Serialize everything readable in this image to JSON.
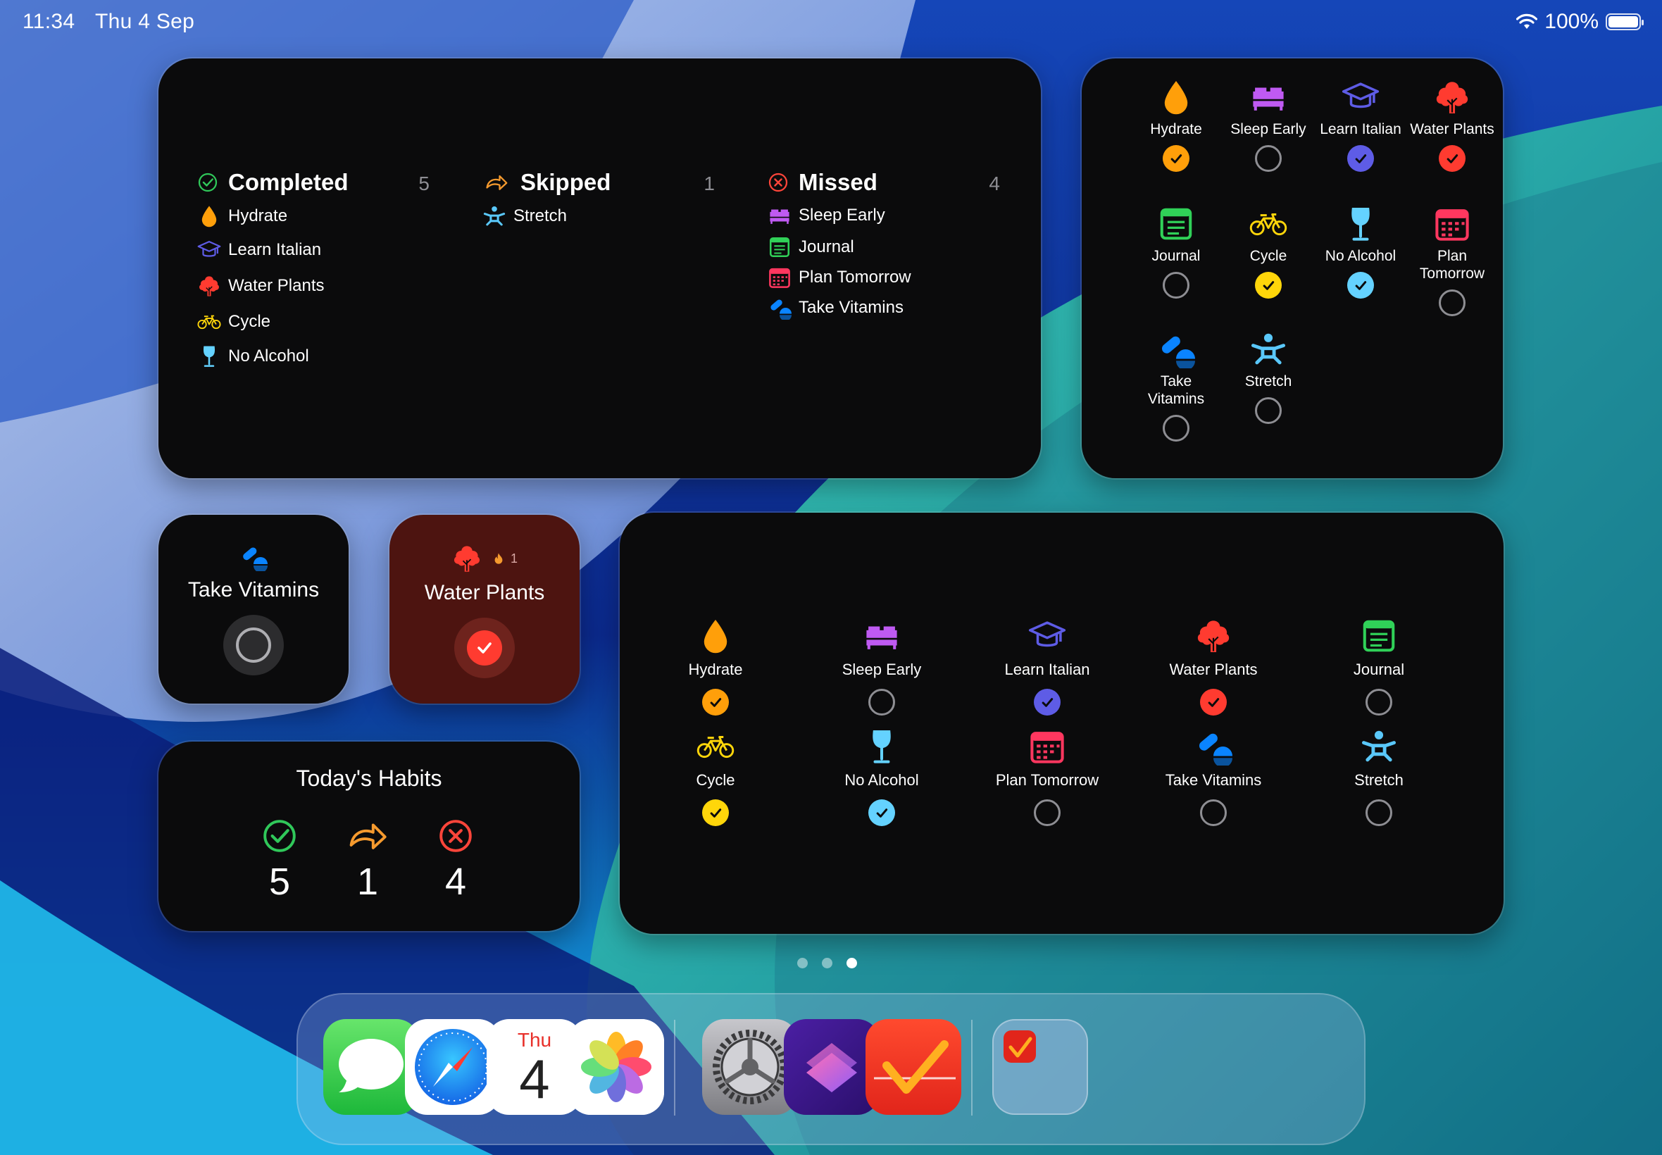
{
  "status_bar": {
    "time": "11:34",
    "date": "Thu 4 Sep",
    "battery": "100%",
    "battery_level": 1.0
  },
  "colors": {
    "completed": "#30c85a",
    "skipped": "#f59a2e",
    "missed": "#ff453a",
    "ring": "#8e8e93",
    "hydrate": "#ff9f0a",
    "sleep": "#bf5af2",
    "italian": "#5e5ce6",
    "plants": "#ff3b30",
    "journal": "#30d158",
    "cycle": "#ffd60a",
    "alcohol": "#64d2ff",
    "plan": "#ff375f",
    "vitamins": "#0a84ff",
    "stretch": "#5ac8fa"
  },
  "summary": {
    "completed": {
      "title": "Completed",
      "count": "5",
      "icon": "check-circle-icon",
      "items": [
        {
          "label": "Hydrate",
          "icon": "drop-icon"
        },
        {
          "label": "Learn Italian",
          "icon": "graduation-cap-icon"
        },
        {
          "label": "Water Plants",
          "icon": "tree-icon"
        },
        {
          "label": "Cycle",
          "icon": "bicycle-icon"
        },
        {
          "label": "No Alcohol",
          "icon": "wineglass-icon"
        }
      ]
    },
    "skipped": {
      "title": "Skipped",
      "count": "1",
      "icon": "skip-arrow-icon",
      "items": [
        {
          "label": "Stretch",
          "icon": "stretch-figure-icon"
        }
      ]
    },
    "missed": {
      "title": "Missed",
      "count": "4",
      "icon": "x-circle-icon",
      "items": [
        {
          "label": "Sleep Early",
          "icon": "bed-icon"
        },
        {
          "label": "Journal",
          "icon": "journal-icon"
        },
        {
          "label": "Plan Tomorrow",
          "icon": "calendar-icon"
        },
        {
          "label": "Take Vitamins",
          "icon": "pills-icon"
        }
      ]
    }
  },
  "grid_widget": {
    "habits": [
      {
        "label": "Hydrate",
        "state": "done",
        "color": "#ff9f0a",
        "icon": "drop-icon"
      },
      {
        "label": "Sleep Early",
        "state": "open",
        "color": "#bf5af2",
        "icon": "bed-icon"
      },
      {
        "label": "Learn Italian",
        "state": "done",
        "color": "#5e5ce6",
        "icon": "graduation-cap-icon"
      },
      {
        "label": "Water Plants",
        "state": "done",
        "color": "#ff3b30",
        "icon": "tree-icon"
      },
      {
        "label": "Journal",
        "state": "open",
        "color": "#30d158",
        "icon": "journal-icon"
      },
      {
        "label": "Cycle",
        "state": "done",
        "color": "#ffd60a",
        "icon": "bicycle-icon"
      },
      {
        "label": "No Alcohol",
        "state": "done",
        "color": "#64d2ff",
        "icon": "wineglass-icon"
      },
      {
        "label": "Plan Tomorrow",
        "state": "open",
        "color": "#ff375f",
        "icon": "calendar-icon"
      },
      {
        "label": "Take Vitamins",
        "state": "open",
        "color": "#0a84ff",
        "icon": "pills-icon"
      },
      {
        "label": "Stretch",
        "state": "open",
        "color": "#5ac8fa",
        "icon": "stretch-figure-icon"
      }
    ]
  },
  "vitamins_widget": {
    "label": "Take Vitamins",
    "icon": "pills-icon",
    "state": "open"
  },
  "plants_widget": {
    "label": "Water Plants",
    "icon": "tree-icon",
    "streak": "1",
    "streak_icon": "flame-icon",
    "state": "done"
  },
  "today_widget": {
    "title": "Today's Habits",
    "completed": "5",
    "skipped": "1",
    "missed": "4"
  },
  "page_indicator": {
    "pages": 3,
    "current": 3
  },
  "dock": {
    "apps": [
      {
        "name": "Messages",
        "icon": "messages-icon"
      },
      {
        "name": "Safari",
        "icon": "safari-compass-icon"
      },
      {
        "name": "Calendar",
        "icon": "calendar-app-icon",
        "day": "Thu",
        "date": "4"
      },
      {
        "name": "Photos",
        "icon": "photos-flower-icon"
      },
      {
        "name": "Settings",
        "icon": "gear-icon"
      },
      {
        "name": "Shortcuts",
        "icon": "shortcuts-icon"
      },
      {
        "name": "Habits",
        "icon": "checkmark-app-icon"
      },
      {
        "name": "App Library",
        "icon": "app-library-icon"
      }
    ]
  }
}
